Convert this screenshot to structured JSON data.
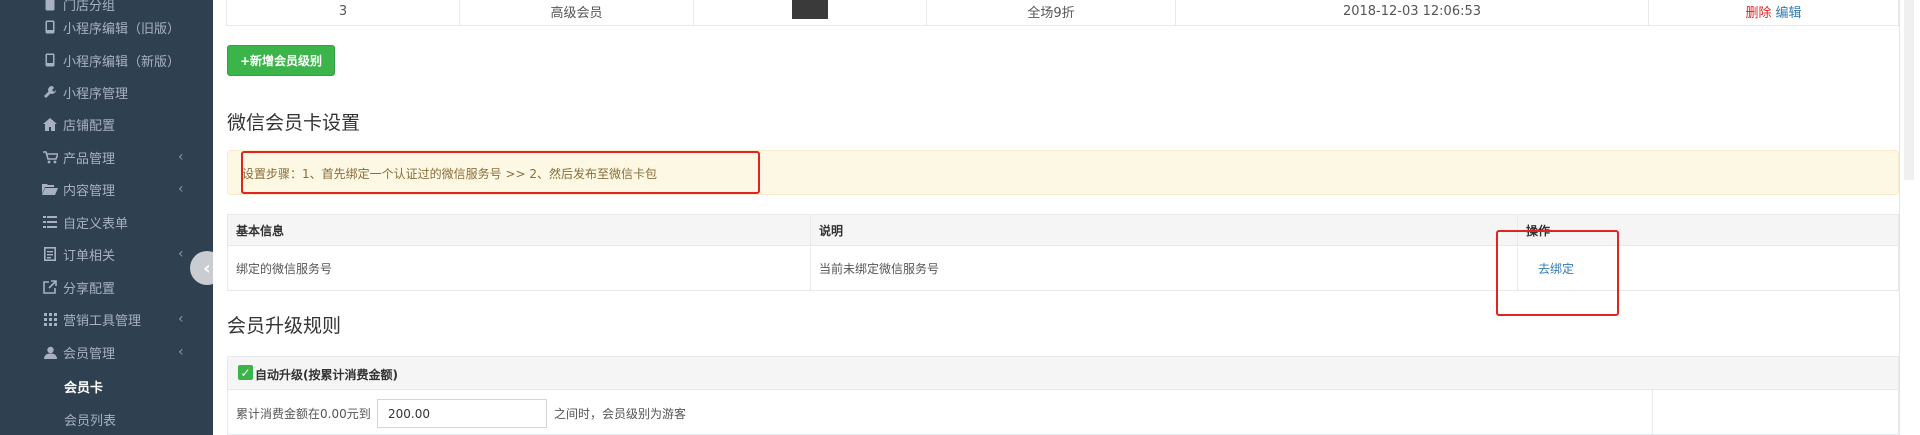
{
  "sidebar": {
    "top_partial_label": "门店分组",
    "items": [
      {
        "label": "小程序编辑（旧版）",
        "icon": "phone-icon"
      },
      {
        "label": "小程序编辑（新版）",
        "icon": "phone-icon"
      },
      {
        "label": "小程序管理",
        "icon": "wrench-icon"
      },
      {
        "label": "店铺配置",
        "icon": "home-icon"
      },
      {
        "label": "产品管理",
        "icon": "cart-icon",
        "arrow": "‹"
      },
      {
        "label": "内容管理",
        "icon": "folder-open-icon",
        "arrow": "‹"
      },
      {
        "label": "自定义表单",
        "icon": "list-icon"
      },
      {
        "label": "订单相关",
        "icon": "document-icon",
        "arrow": "‹"
      },
      {
        "label": "分享配置",
        "icon": "share-icon"
      },
      {
        "label": "营销工具管理",
        "icon": "grid-icon",
        "arrow": "‹"
      },
      {
        "label": "会员管理",
        "icon": "user-icon",
        "arrow": "‹"
      }
    ],
    "sub_items": [
      {
        "label": "会员卡",
        "active": true
      },
      {
        "label": "会员列表",
        "active": false
      }
    ],
    "collapse_glyph": "‹"
  },
  "level_table": {
    "row": {
      "level": "3",
      "name": "高级会员",
      "discount": "全场9折",
      "created": "2018-12-03 12:06:53",
      "delete_label": "删除",
      "edit_label": "编辑"
    }
  },
  "add_level_button": "+新增会员级别",
  "wechat_section": {
    "title": "微信会员卡设置",
    "alert": "设置步骤：1、首先绑定一个认证过的微信服务号 >> 2、然后发布至微信卡包",
    "headers": [
      "基本信息",
      "说明",
      "操作"
    ],
    "row": {
      "info": "绑定的微信服务号",
      "desc": "当前未绑定微信服务号",
      "action": "去绑定"
    }
  },
  "upgrade_section": {
    "title": "会员升级规则",
    "checkbox_label": "自动升级(按累计消费金额)",
    "rule_prefix": "累计消费金额在0.00元到",
    "amount_value": "200.00",
    "rule_suffix": "之间时，会员级别为游客"
  },
  "colors": {
    "sidebar_bg": "#2f4050",
    "accent_green": "#3bb44a",
    "annotation_red": "#e32222",
    "link_blue": "#337ab7",
    "delete_red": "#e32222"
  }
}
